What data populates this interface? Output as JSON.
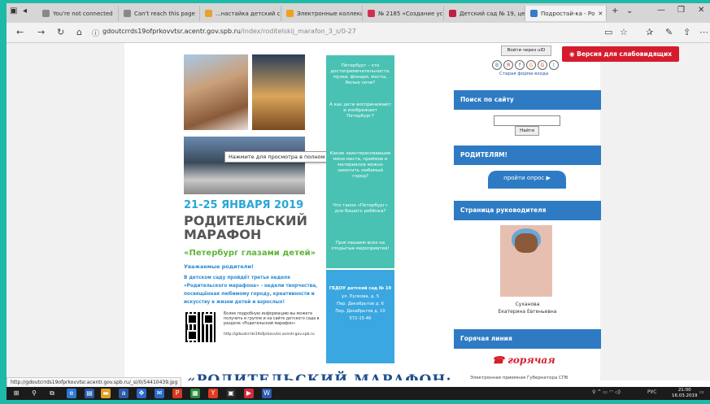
{
  "tabs": [
    {
      "label": "You're not connected",
      "color": "#888888",
      "active": false
    },
    {
      "label": "Can't reach this page",
      "color": "#888888",
      "active": false
    },
    {
      "label": "...настайка детский с",
      "color": "#e8a030",
      "active": false
    },
    {
      "label": "Электронные коллекц",
      "color": "#f0a020",
      "active": false
    },
    {
      "label": "№ 2185 «Создание ус",
      "color": "#d03050",
      "active": false
    },
    {
      "label": "Детский сад № 19, цен",
      "color": "#c02040",
      "active": false
    },
    {
      "label": "Подростай-ка - Ро",
      "color": "#3a7ac8",
      "active": true
    }
  ],
  "address": {
    "url_main": "gdoutcrrds19ofprkovvtsr.acentr.gov.spb.ru",
    "url_path": "/index/roditelskij_marafon_3_s/0-27"
  },
  "poster": {
    "tooltip": "Нажмите для просмотра в полном размере...",
    "dates": "21-25 ЯНВАРЯ 2019",
    "title_line1": "РОДИТЕЛЬСКИЙ",
    "title_line2": "МАРАФОН",
    "subtitle": "«Петербург глазами детей»",
    "greeting": "Уважаемые родители!",
    "paragraph": "В детском саду пройдёт третья неделя «Родительского марафона» - недели творчества, посвящённая любимому городу, креативности и искусству в жизни детей и взрослых!",
    "qr_note": "Более подробную информацию вы можете получить в группе и на сайте детского сада в разделе «Родительский марафон»",
    "qr_url": "http://gdoutcrrds19ofprkovvtsr.acentr.gov.spb.ru",
    "teal_blocks": [
      "Петербург – это достопримечательности, музеи, фонари, мосты, белые ночи?",
      "А как дети воспринимают и изображают Петербург?",
      "Какие заинтересовавшие меня места, приёмов и материалов можно заметить любимый город?",
      "Что такое «Петербург» для Вашего ребёнка?",
      "Приглашаем всех на открытые мероприятия!"
    ],
    "blue_block": [
      "ГБДОУ детский сад № 19",
      "ул. Пулкова, д. 5",
      "Пер. Декабрьтов д. 6",
      "Пер. Декабрьтов д. 10",
      "572-15-46"
    ],
    "big_title": "«РОДИТЕЛЬСКИЙ МАРАФОН:"
  },
  "sidebar": {
    "login_label": "Войти через uID",
    "social": [
      "В",
      "Я",
      "f",
      "G",
      "G",
      "t"
    ],
    "old_form": "Старая форма входа",
    "accessibility": "◉ Версия для слабовидящих",
    "search_title": "Поиск по сайту",
    "search_button": "Найти",
    "parents_title": "РОДИТЕЛЯМ!",
    "survey_label": "пройти опрос ▶",
    "director_title": "Страница руководителя",
    "director_name1": "Суханова",
    "director_name2": "Екатерина Евгеньевна",
    "hotline_title": "Горячая линия",
    "hotline_logo": "горячая",
    "hotline_line1": "Электронная приемная Губернатора СПб"
  },
  "status_link": "http://gdoutcrrds19ofprkovvtsr.acentr.gov.spb.ru/_si/0/54410439.jpg",
  "tray": {
    "lang": "РУС",
    "time": "21:00",
    "date": "16.03.2019"
  }
}
